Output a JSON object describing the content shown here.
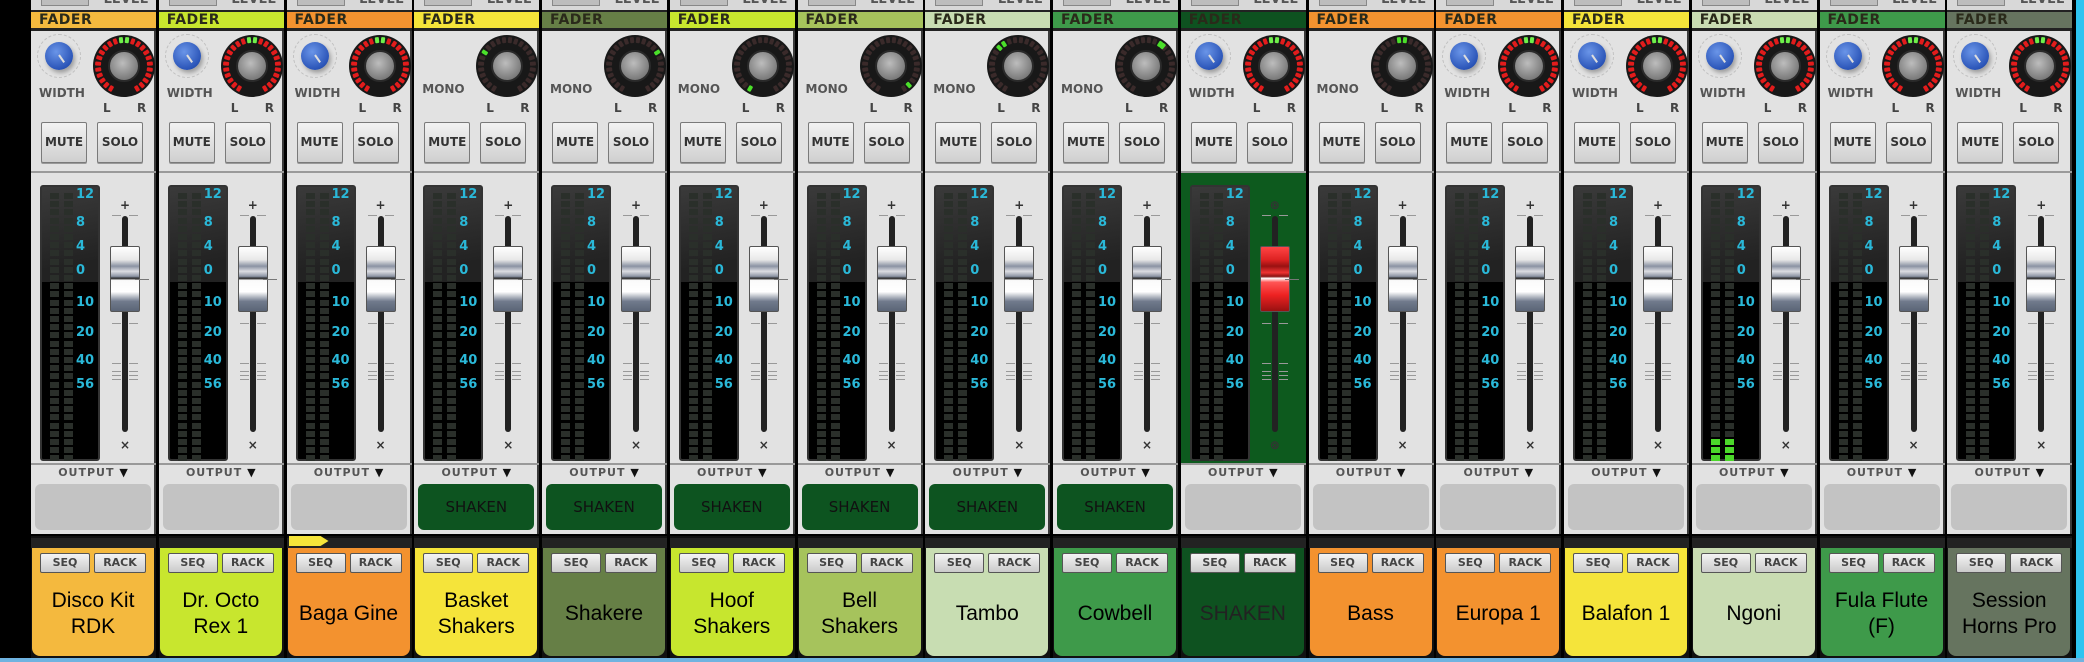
{
  "labels": {
    "top_level": "LEVEL",
    "fader": "FADER",
    "width": "WIDTH",
    "mono": "MONO",
    "left": "L",
    "right": "R",
    "mute": "MUTE",
    "solo": "SOLO",
    "output": "OUTPUT",
    "seq": "SEQ",
    "rack": "RACK"
  },
  "meter_scale": [
    "12",
    "8",
    "4",
    "0",
    "10",
    "20",
    "40",
    "56"
  ],
  "channels": [
    {
      "name": "Disco Kit RDK",
      "color": "#f4b93e",
      "mode": "stereo",
      "pan": 0,
      "output": "",
      "fader_db": 0,
      "meter_level": 0
    },
    {
      "name": "Dr. Octo Rex 1",
      "color": "#c8e62e",
      "mode": "stereo",
      "pan": 0,
      "output": "",
      "fader_db": 0,
      "meter_level": 0
    },
    {
      "name": "Baga Gine",
      "color": "#f3922f",
      "mode": "stereo",
      "pan": 0,
      "output": "",
      "fader_db": 0,
      "meter_level": 0,
      "playing": true
    },
    {
      "name": "Basket Shakers",
      "color": "#f5e43a",
      "mode": "mono",
      "pan": -60,
      "output": "SHAKEN",
      "fader_db": 0,
      "meter_level": 0
    },
    {
      "name": "Shakere",
      "color": "#667f46",
      "mode": "mono",
      "pan": 60,
      "output": "SHAKEN",
      "fader_db": 0,
      "meter_level": 0
    },
    {
      "name": "Hoof Shakers",
      "color": "#c7e62e",
      "mode": "mono",
      "pan": -150,
      "output": "SHAKEN",
      "fader_db": 0,
      "meter_level": 0
    },
    {
      "name": "Bell Shakers",
      "color": "#a6c35c",
      "mode": "mono",
      "pan": 140,
      "output": "SHAKEN",
      "fader_db": 0,
      "meter_level": 0
    },
    {
      "name": "Tambo",
      "color": "#c8ddb2",
      "mode": "mono",
      "pan": -40,
      "output": "SHAKEN",
      "fader_db": 0,
      "meter_level": 0
    },
    {
      "name": "Cowbell",
      "color": "#3e9a4a",
      "mode": "mono",
      "pan": 30,
      "output": "SHAKEN",
      "fader_db": 0,
      "meter_level": 0
    },
    {
      "name": "SHAKEN",
      "color": "#0e5220",
      "mode": "stereo",
      "pan": 0,
      "output": "",
      "fader_db": 0,
      "meter_level": 0,
      "bus": true
    },
    {
      "name": "Bass",
      "color": "#f3922f",
      "mode": "mono",
      "pan": 0,
      "output": "",
      "fader_db": 0,
      "meter_level": 0
    },
    {
      "name": "Europa 1",
      "color": "#f3922f",
      "mode": "stereo",
      "pan": 0,
      "output": "",
      "fader_db": 0,
      "meter_level": 0
    },
    {
      "name": "Balafon 1",
      "color": "#f5e43a",
      "mode": "stereo",
      "pan": 0,
      "output": "",
      "fader_db": 0,
      "meter_level": 0
    },
    {
      "name": "Ngoni",
      "color": "#c9dcb2",
      "mode": "stereo",
      "pan": 0,
      "output": "",
      "fader_db": 0,
      "meter_level": 3
    },
    {
      "name": "Fula Flute (F)",
      "color": "#3e9a4a",
      "mode": "stereo",
      "pan": 0,
      "output": "",
      "fader_db": 0,
      "meter_level": 0
    },
    {
      "name": "Session Horns Pro",
      "color": "#66745f",
      "mode": "stereo",
      "pan": 0,
      "output": "",
      "fader_db": 0,
      "meter_level": 0
    }
  ]
}
